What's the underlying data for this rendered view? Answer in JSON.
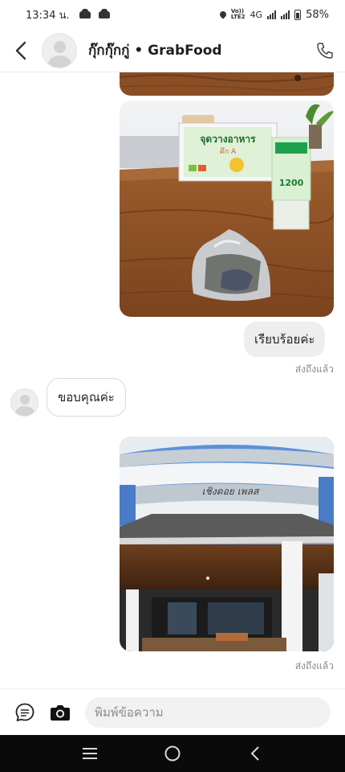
{
  "status_bar": {
    "time": "13:34 น.",
    "network_label_top": "Vo))",
    "network_label_bottom": "LTE2",
    "network_type": "4G",
    "battery": "58%"
  },
  "header": {
    "title": "กุ๊กกุ๊กกู่ • GrabFood",
    "back_icon": "chevron-left-icon",
    "call_icon": "phone-icon"
  },
  "messages": [
    {
      "type": "image",
      "direction": "outgoing",
      "alt_icon": "photo-partial-table"
    },
    {
      "type": "image",
      "direction": "outgoing",
      "alt_icon": "photo-food-bag-on-table",
      "sign_text": "จุดวางอาหาร",
      "sign_sub": "ตึก A",
      "promo_text": "1200"
    },
    {
      "type": "text",
      "direction": "outgoing",
      "text": "เรียบร้อยค่ะ",
      "receipt": "ส่งถึงแล้ว"
    },
    {
      "type": "text",
      "direction": "incoming",
      "text": "ขอบคุณค่ะ"
    },
    {
      "type": "image",
      "direction": "outgoing",
      "alt_icon": "photo-building-entrance",
      "sign_text": "เชิงดอย เพลส",
      "receipt": "ส่งถึงแล้ว"
    }
  ],
  "composer": {
    "placeholder": "พิมพ์ข้อความ",
    "chat_icon": "chat-bubble-icon",
    "camera_icon": "camera-icon"
  },
  "nav": {
    "recents_icon": "recents-icon",
    "home_icon": "home-icon",
    "back_icon": "back-icon"
  },
  "colors": {
    "outgoing_bubble": "#eeeeee",
    "incoming_border": "#d9d9d9",
    "receipt_text": "#8a8a8a",
    "navbar": "#0a0a0a"
  }
}
